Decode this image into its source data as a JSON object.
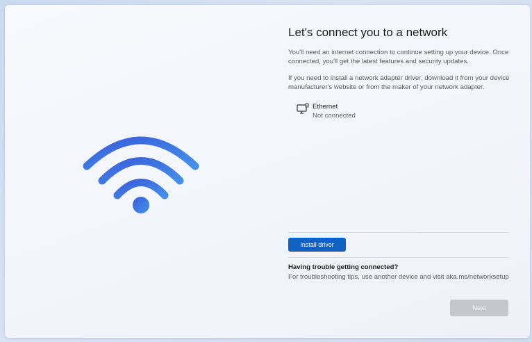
{
  "page": {
    "title": "Let's connect you to a network",
    "description_1": "You'll need an internet connection to continue setting up your device. Once connected, you'll get the latest features and security updates.",
    "description_2": "If you need to install a network adapter driver, download it from your device manufacturer's website or from the maker of your network adapter."
  },
  "network": {
    "icon": "ethernet-computer-icon",
    "name": "Ethernet",
    "status": "Not connected"
  },
  "actions": {
    "install_driver_label": "Install driver",
    "next_label": "Next",
    "next_enabled": false
  },
  "help": {
    "heading": "Having trouble getting connected?",
    "text": "For troubleshooting tips, use another device and visit aka.ms/networksetup"
  },
  "illustration": {
    "icon": "wifi-icon"
  },
  "colors": {
    "accent": "#0f62c2",
    "wifi_gradient_start": "#3c6ae0",
    "wifi_gradient_end": "#3f86e6",
    "disabled_button": "#c4c7cb"
  }
}
